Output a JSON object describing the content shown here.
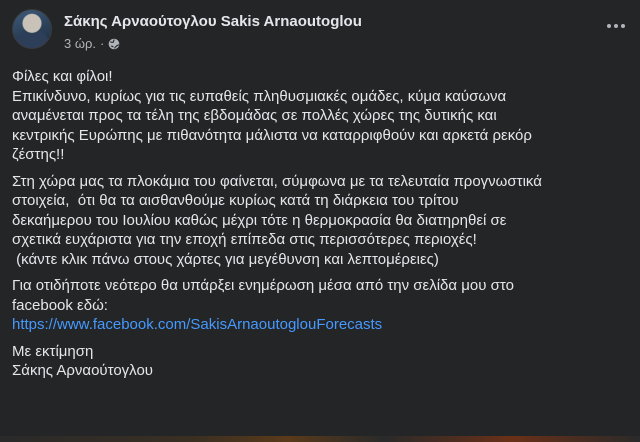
{
  "post": {
    "author": "Σάκης Αρναούτογλου Sakis Arnaoutoglou",
    "time": "3 ώρ.",
    "separator": "·",
    "audience_icon": "globe-icon",
    "more_icon": "more-options-icon",
    "paragraphs": [
      "Φίλες και φίλοι!\nΕπικίνδυνο, κυρίως για τις ευπαθείς πληθυσμιακές ομάδες, κύμα καύσωνα\nαναμένεται προς τα τέλη της εβδομάδας σε πολλές χώρες της δυτικής και\nκεντρικής Ευρώπης με πιθανότητα μάλιστα να καταρριφθούν και αρκετά ρεκόρ\nζέστης!!",
      "Στη χώρα μας τα πλοκάμια του φαίνεται, σύμφωνα με τα τελευταία προγνωστικά\nστοιχεία,  ότι θα τα αισθανθούμε κυρίως κατά τη διάρκεια του τρίτου\nδεκαήμερου του Ιουλίου καθώς μέχρι τότε η θερμοκρασία θα διατηρηθεί σε\nσχετικά ευχάριστα για την εποχή επίπεδα στις περισσότερες περιοχές!\n (κάντε κλικ πάνω στους χάρτες για μεγέθυνση και λεπτομέρειες)",
      "Για οτιδήποτε νεότερο θα υπάρξει ενημέρωση μέσα από την σελίδα μου στο\nfacebook εδώ:"
    ],
    "link": "https://www.facebook.com/SakisArnaoutoglouForecasts",
    "signoff": "Με εκτίμηση\nΣάκης Αρναούτογλου"
  },
  "colors": {
    "background": "#242526",
    "text": "#e4e6eb",
    "secondary_text": "#b0b3b8",
    "link": "#4599ff"
  }
}
